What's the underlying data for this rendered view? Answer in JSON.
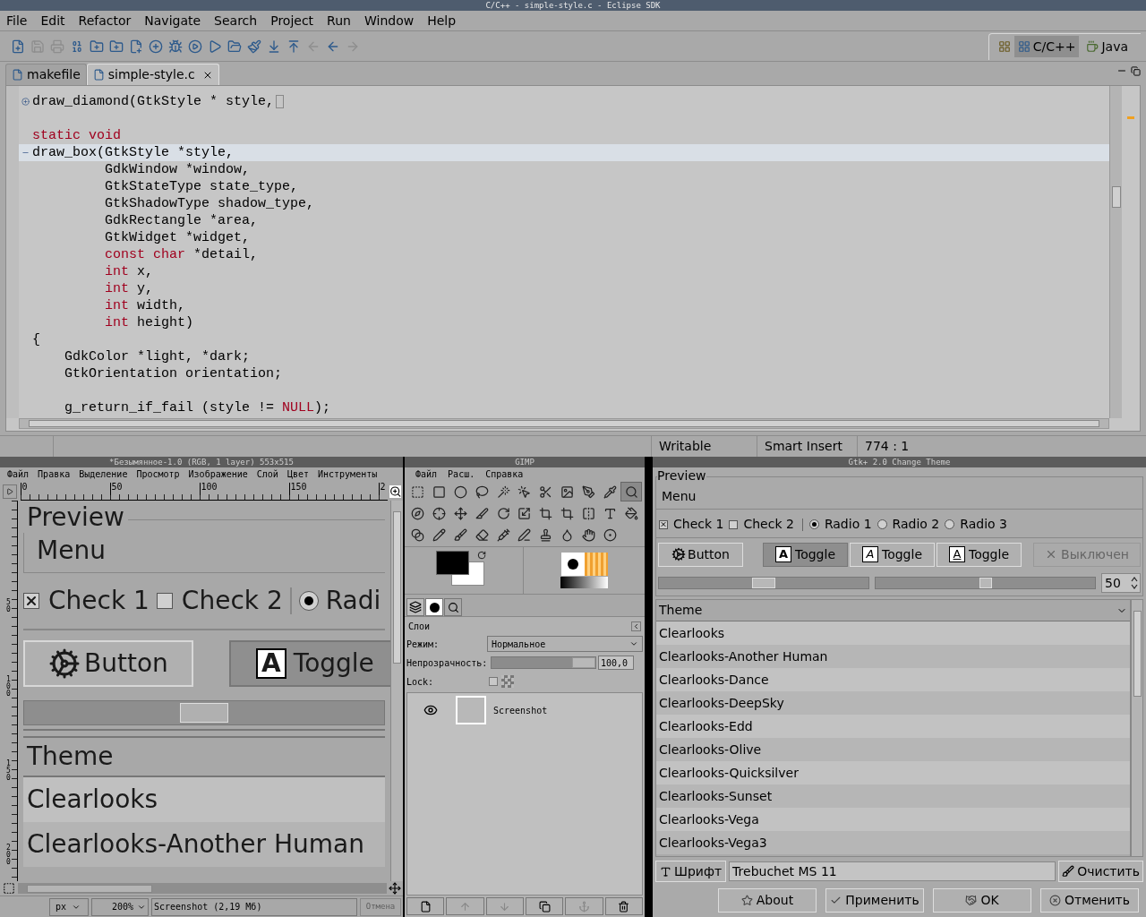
{
  "eclipse": {
    "title": "C/C++ - simple-style.c - Eclipse SDK",
    "menu": [
      "File",
      "Edit",
      "Refactor",
      "Navigate",
      "Search",
      "Project",
      "Run",
      "Window",
      "Help"
    ],
    "perspectives": [
      {
        "label": "C/C++",
        "selected": true
      },
      {
        "label": "Java",
        "selected": false
      }
    ],
    "tabs": [
      {
        "label": "makefile",
        "selected": false
      },
      {
        "label": "simple-style.c",
        "selected": true
      }
    ],
    "code": [
      {
        "current": false,
        "expanded": false,
        "segments": [
          {
            "kind": "plain",
            "text": "draw_diamond(GtkStyle * style,"
          }
        ]
      },
      {
        "current": false
      },
      {
        "current": false,
        "segments": [
          {
            "kind": "keyword",
            "text": "static void"
          }
        ]
      },
      {
        "current": true,
        "expanded": true,
        "segments": [
          {
            "kind": "plain",
            "text": "draw_box(GtkStyle *style,"
          }
        ]
      },
      {
        "current": false,
        "segments": [
          {
            "kind": "plain",
            "text": "         GdkWindow *window,"
          }
        ]
      },
      {
        "current": false,
        "segments": [
          {
            "kind": "plain",
            "text": "         GtkStateType state_type,"
          }
        ]
      },
      {
        "current": false,
        "segments": [
          {
            "kind": "plain",
            "text": "         GtkShadowType shadow_type,"
          }
        ]
      },
      {
        "current": false,
        "segments": [
          {
            "kind": "plain",
            "text": "         GdkRectangle *area,"
          }
        ]
      },
      {
        "current": false,
        "segments": [
          {
            "kind": "plain",
            "text": "         GtkWidget *widget,"
          }
        ]
      },
      {
        "current": false,
        "segments": [
          {
            "kind": "keyword",
            "text": "         const char"
          },
          {
            "kind": "plain",
            "text": " *detail,"
          }
        ]
      },
      {
        "current": false,
        "segments": [
          {
            "kind": "keyword",
            "text": "         int"
          },
          {
            "kind": "plain",
            "text": " x,"
          }
        ]
      },
      {
        "current": false,
        "segments": [
          {
            "kind": "keyword",
            "text": "         int"
          },
          {
            "kind": "plain",
            "text": " y,"
          }
        ]
      },
      {
        "current": false,
        "segments": [
          {
            "kind": "keyword",
            "text": "         int"
          },
          {
            "kind": "plain",
            "text": " width,"
          }
        ]
      },
      {
        "current": false,
        "segments": [
          {
            "kind": "keyword",
            "text": "         int"
          },
          {
            "kind": "plain",
            "text": " height)"
          }
        ]
      },
      {
        "current": false,
        "segments": [
          {
            "kind": "plain",
            "text": "{"
          }
        ]
      },
      {
        "current": false,
        "segments": [
          {
            "kind": "plain",
            "text": "    GdkColor *light, *dark;"
          }
        ]
      },
      {
        "current": false,
        "segments": [
          {
            "kind": "plain",
            "text": "    GtkOrientation orientation;"
          }
        ]
      },
      {
        "current": false
      },
      {
        "current": false,
        "segments": [
          {
            "kind": "plain",
            "text": "    g_return_if_fail (style != "
          },
          {
            "kind": "keyword",
            "text": "NULL"
          },
          {
            "kind": "plain",
            "text": ");"
          }
        ]
      }
    ],
    "status": [
      "Writable",
      "Smart Insert",
      "774 : 1"
    ]
  },
  "gimp_image": {
    "title": "*Безымянное-1.0 (RGB, 1 layer) 553x515",
    "menu": [
      "Файл",
      "Правка",
      "Выделение",
      "Просмотр",
      "Изображение",
      "Слой",
      "Цвет",
      "Инструменты"
    ],
    "ruler": [
      "0",
      "50",
      "100",
      "150",
      "2"
    ],
    "vruler": [
      "5\n0",
      "1\n0\n0",
      "1\n5\n0",
      "2\n0\n0"
    ],
    "canvas": {
      "frame": "Preview",
      "menu": "Menu",
      "checks": [
        {
          "label": "Check 1",
          "checked": true
        },
        {
          "label": "Check 2",
          "checked": false
        }
      ],
      "radio": {
        "label": "Radi",
        "selected": true
      },
      "button": "Button",
      "toggle": {
        "icon": "A",
        "label": "Toggle"
      },
      "header": "Theme",
      "items": [
        "Clearlooks",
        "Clearlooks-Another Human"
      ]
    },
    "unit": "px",
    "zoom": "200%",
    "info": "Screenshot (2,19 Мб)",
    "cancel": {
      "label": "Отмена",
      "disabled": true
    }
  },
  "gimp_toolbox": {
    "title": "GIMP",
    "menu": [
      "Файл",
      "Расш.",
      "Справка"
    ],
    "tools": [
      {
        "selected": false
      },
      {
        "selected": false
      },
      {
        "selected": false
      },
      {
        "selected": false
      },
      {
        "selected": false
      },
      {
        "selected": false
      },
      {
        "selected": false
      },
      {
        "selected": false
      },
      {
        "selected": false
      },
      {
        "selected": false
      },
      {
        "selected": true
      },
      {
        "selected": false
      },
      {
        "selected": false
      },
      {
        "selected": false
      },
      {
        "selected": false
      },
      {
        "selected": false
      },
      {
        "selected": false
      },
      {
        "selected": false
      },
      {
        "selected": false
      },
      {
        "selected": false
      },
      {
        "selected": false
      },
      {
        "selected": false
      },
      {
        "selected": false
      },
      {
        "selected": false
      },
      {
        "selected": false
      },
      {
        "selected": false
      },
      {
        "selected": false
      },
      {
        "selected": false
      },
      {
        "selected": false
      },
      {
        "selected": false
      },
      {
        "selected": false
      },
      {
        "selected": false
      }
    ],
    "dock_title": "Слои",
    "mode_label": "Режим:",
    "mode": "Нормальное",
    "opacity_label": "Непрозрачность:",
    "opacity": {
      "value": "100,0",
      "level": 1
    },
    "lock_label": "Lock:",
    "lock": {
      "checked": false
    },
    "layers": [
      {
        "name": "Screenshot",
        "visible": true
      }
    ]
  },
  "theme": {
    "title": "Gtk+ 2.0 Change Theme",
    "frame": "Preview",
    "menu": "Menu",
    "checks": [
      {
        "label": "Check 1",
        "checked": true
      },
      {
        "label": "Check 2",
        "checked": false
      }
    ],
    "radios": [
      {
        "label": "Radio 1",
        "selected": true
      },
      {
        "label": "Radio 2",
        "selected": false
      },
      {
        "label": "Radio 3",
        "selected": false
      }
    ],
    "button": "Button",
    "toggles": [
      {
        "icon": "A",
        "label": "Toggle",
        "selected": true
      },
      {
        "icon": "A",
        "label": "Toggle",
        "selected": false
      },
      {
        "icon": "A",
        "label": "Toggle",
        "selected": false
      }
    ],
    "disabled_button": {
      "label": "Выключен",
      "disabled": true
    },
    "scale": {
      "level": 0.5
    },
    "scrollbar": {
      "level": 0.5
    },
    "spin": "50",
    "list_header": "Theme",
    "themes": [
      "Clearlooks",
      "Clearlooks-Another Human",
      "Clearlooks-Dance",
      "Clearlooks-DeepSky",
      "Clearlooks-Edd",
      "Clearlooks-Olive",
      "Clearlooks-Quicksilver",
      "Clearlooks-Sunset",
      "Clearlooks-Vega",
      "Clearlooks-Vega3"
    ],
    "font_button": "Шрифт",
    "font": "Trebuchet MS 11",
    "clear": "Очистить",
    "buttons": [
      {
        "label": "About",
        "kind": "about"
      },
      {
        "label": "Применить",
        "kind": "apply"
      },
      {
        "label": "OK",
        "kind": "ok"
      },
      {
        "label": "Отменить",
        "kind": "cancel"
      }
    ]
  }
}
